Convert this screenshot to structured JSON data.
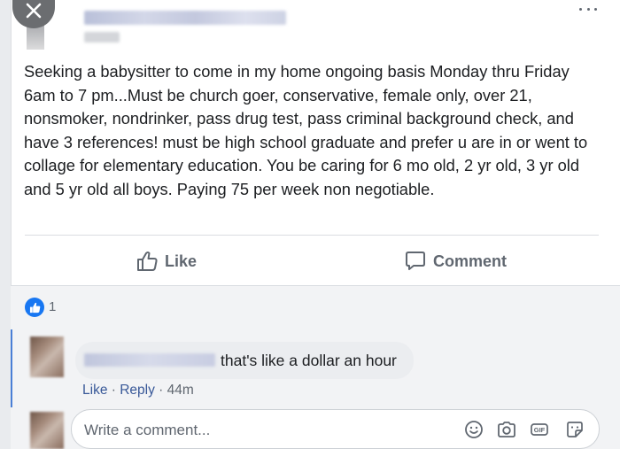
{
  "post": {
    "text": "Seeking a babysitter to come in my home ongoing basis Monday thru Friday 6am to 7 pm...Must be church goer, conservative, female only, over 21, nonsmoker, nondrinker, pass drug test, pass criminal background check, and have 3 references! must be high school graduate and prefer u are in or went to collage for elementary education. You be caring for 6 mo old, 2 yr old, 3 yr old and 5 yr old all boys. Paying 75 per week non negotiable."
  },
  "actions": {
    "like_label": "Like",
    "comment_label": "Comment"
  },
  "reactions": {
    "count": "1"
  },
  "comment": {
    "text": "that's like a dollar an hour",
    "like_label": "Like",
    "separator": " · ",
    "reply_label": "Reply",
    "time": " · 44m"
  },
  "composer": {
    "placeholder": "Write a comment..."
  },
  "colors": {
    "brand_blue": "#1877f2",
    "link": "#385898",
    "secondary_text": "#606770"
  },
  "icons": {
    "close": "close-icon",
    "more": "more-options-icon",
    "like": "thumbs-up-icon",
    "comment": "speech-bubble-icon",
    "emoji": "emoji-icon",
    "camera": "camera-icon",
    "gif": "gif-icon",
    "sticker": "sticker-icon"
  }
}
